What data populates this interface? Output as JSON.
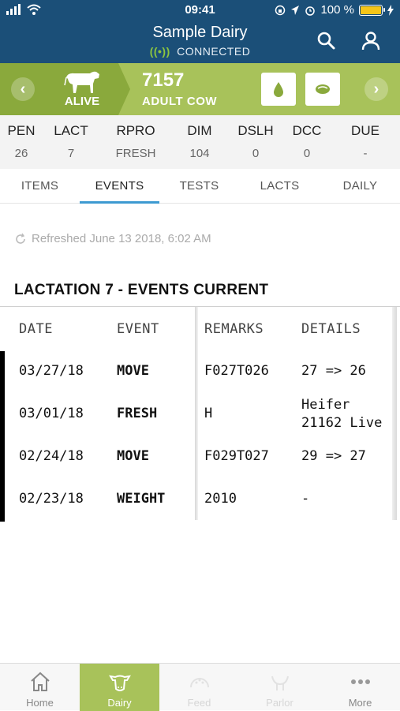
{
  "status_bar": {
    "time": "09:41",
    "battery": "100 %",
    "battery_level": 1.0,
    "icons": [
      "signal-icon",
      "wifi-icon",
      "lock-rotation-icon",
      "location-icon",
      "alarm-icon",
      "battery-icon",
      "charging-icon"
    ]
  },
  "header": {
    "title": "Sample Dairy",
    "connection": "CONNECTED",
    "accent": "#1b4f78"
  },
  "animal": {
    "status": "ALIVE",
    "id": "7157",
    "type": "ADULT COW",
    "panel_color": "#a8c25a"
  },
  "stats": [
    {
      "label": "PEN",
      "value": "26"
    },
    {
      "label": "LACT",
      "value": "7"
    },
    {
      "label": "RPRO",
      "value": "FRESH"
    },
    {
      "label": "DIM",
      "value": "104"
    },
    {
      "label": "DSLH",
      "value": "0"
    },
    {
      "label": "DCC",
      "value": "0"
    },
    {
      "label": "DUE",
      "value": "-"
    }
  ],
  "tabs": [
    {
      "label": "ITEMS",
      "active": false
    },
    {
      "label": "EVENTS",
      "active": true
    },
    {
      "label": "TESTS",
      "active": false
    },
    {
      "label": "LACTS",
      "active": false
    },
    {
      "label": "DAILY",
      "active": false
    }
  ],
  "refreshed": "Refreshed June 13 2018, 6:02 AM",
  "section_title": "LACTATION 7 - EVENTS CURRENT",
  "table": {
    "headers": [
      "DATE",
      "EVENT",
      "REMARKS",
      "DETAILS"
    ],
    "rows": [
      {
        "date": "03/27/18",
        "event": "MOVE",
        "remarks": "F027T026",
        "details": "27 => 26",
        "details2": ""
      },
      {
        "date": "03/01/18",
        "event": "FRESH",
        "remarks": "H",
        "details": "Heifer",
        "details2": "21162 Live"
      },
      {
        "date": "02/24/18",
        "event": "MOVE",
        "remarks": "F029T027",
        "details": "29 => 27",
        "details2": ""
      },
      {
        "date": "02/23/18",
        "event": "WEIGHT",
        "remarks": "2010",
        "details": "-",
        "details2": ""
      }
    ]
  },
  "bottom_nav": [
    {
      "label": "Home",
      "icon": "home-icon",
      "active": false
    },
    {
      "label": "Dairy",
      "icon": "cow-head-icon",
      "active": true
    },
    {
      "label": "Feed",
      "icon": "feed-icon",
      "active": false
    },
    {
      "label": "Parlor",
      "icon": "parlor-icon",
      "active": false
    },
    {
      "label": "More",
      "icon": "more-dots-icon",
      "active": false
    }
  ]
}
